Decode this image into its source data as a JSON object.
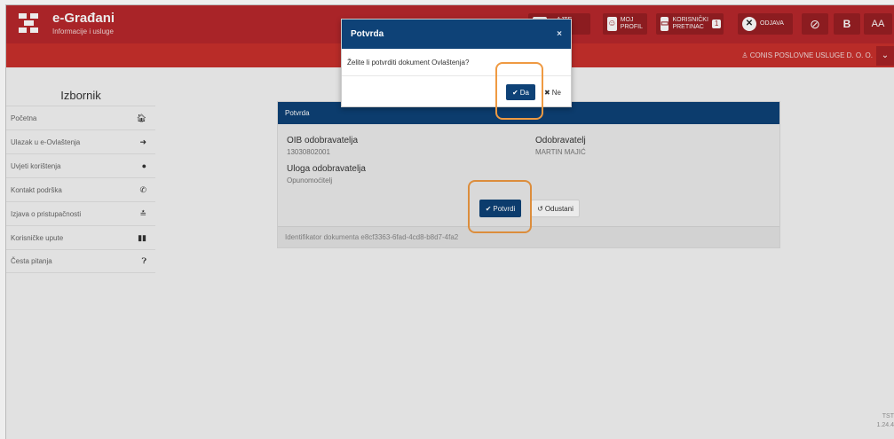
{
  "header": {
    "brand_title": "e-Građani",
    "brand_subtitle": "Informacije i usluge",
    "buttons": [
      {
        "label_line1": "",
        "label_line2": "…AJTE\n…E",
        "icon": "document-icon"
      },
      {
        "label_line1": "MOJ",
        "label_line2": "PROFIL",
        "icon": "profile-icon"
      },
      {
        "label_line1": "KORISNIČKI",
        "label_line2": "PRETINAC",
        "icon": "inbox-icon",
        "count": "1"
      },
      {
        "label_line1": "ODJAVA",
        "label_line2": "",
        "icon": "close-circle-icon"
      }
    ],
    "accessibility_icons": [
      "eye-slash-icon",
      "font-b-icon",
      "font-size-icon"
    ],
    "font_size_label": "AA",
    "b_label": "B",
    "company": "CONIS POSLOVNE USLUGE D. O. O."
  },
  "sidebar": {
    "title": "Izbornik",
    "items": [
      {
        "label": "Početna",
        "icon": "home-icon"
      },
      {
        "label": "Ulazak u e-Ovlaštenja",
        "icon": "sign-in-icon"
      },
      {
        "label": "Uvjeti korištenja",
        "icon": "info-icon"
      },
      {
        "label": "Kontakt podrška",
        "icon": "phone-icon"
      },
      {
        "label": "Izjava o pristupačnosti",
        "icon": "accessibility-icon"
      },
      {
        "label": "Korisničke upute",
        "icon": "book-icon"
      },
      {
        "label": "Česta pitanja",
        "icon": "question-icon"
      }
    ]
  },
  "card": {
    "header": "Potvrda",
    "oib_label": "OIB odobravatelja",
    "oib_value": "13030802001",
    "approver_label": "Odobravatelj",
    "approver_value": "MARTIN MAJIĆ",
    "role_label": "Uloga odobravatelja",
    "role_value": "Opunomoćitelj",
    "confirm_button": "Potvrdi",
    "cancel_button": "Odustani",
    "footer": "Identifikator dokumenta e8cf3363-6fad-4cd8-b8d7-4fa2"
  },
  "modal": {
    "title": "Potvrda",
    "close": "×",
    "question": "Želite li potvrditi dokument Ovlaštenja?",
    "yes": "Da",
    "no": "Ne"
  },
  "version": {
    "line1": "TST",
    "line2": "1.24.4"
  },
  "colors": {
    "brand_red": "#b8282c",
    "navy": "#0e4277",
    "highlight": "#ef9a42"
  }
}
